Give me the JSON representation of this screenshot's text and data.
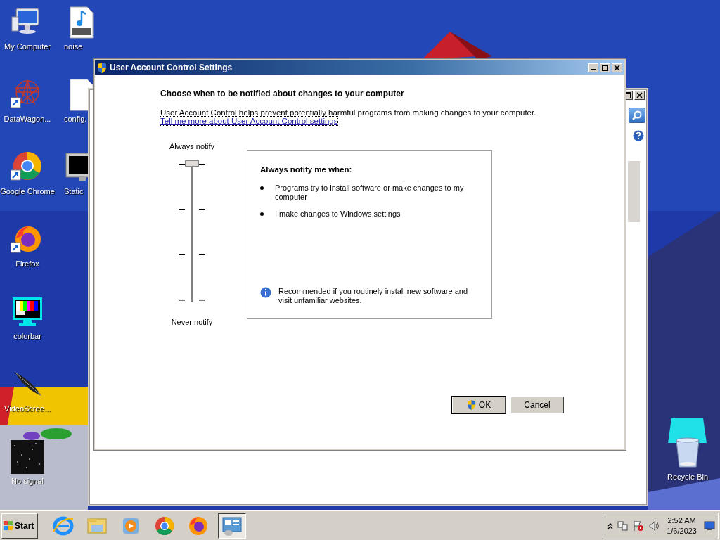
{
  "desktop": {
    "icons": [
      {
        "label": "My Computer",
        "kind": "computer",
        "shortcut": false
      },
      {
        "label": "DataWagon...",
        "kind": "star_pattern",
        "shortcut": true
      },
      {
        "label": "Google Chrome",
        "kind": "chrome",
        "shortcut": true
      },
      {
        "label": "Firefox",
        "kind": "firefox",
        "shortcut": true
      },
      {
        "label": "colorbar",
        "kind": "colorbar",
        "shortcut": false
      },
      {
        "label": "VideoScree...",
        "kind": "feather",
        "shortcut": false
      },
      {
        "label": "No signal",
        "kind": "noise",
        "shortcut": false
      }
    ],
    "icons_column_2": [
      {
        "label": "noise",
        "kind": "audio_file",
        "shortcut": false
      },
      {
        "label": "config.",
        "kind": "document",
        "shortcut": false
      },
      {
        "label": "Static",
        "kind": "monitor",
        "shortcut": false
      }
    ],
    "recycle_bin": {
      "label": "Recycle Bin"
    }
  },
  "dialog": {
    "title": "User Account Control Settings",
    "heading": "Choose when to be notified about changes to your computer",
    "description": "User Account Control helps prevent potentially harmful programs from making changes to your computer.",
    "link": "Tell me more about User Account Control settings",
    "slider": {
      "top_label": "Always notify",
      "bottom_label": "Never notify",
      "level": 1
    },
    "info_box": {
      "title": "Always notify me when:",
      "bullets": [
        "Programs try to install software or make changes to my computer",
        "I make changes to Windows settings"
      ],
      "note": "Recommended if you routinely install new software and visit unfamiliar websites."
    },
    "buttons": [
      {
        "label": "OK",
        "shield": true
      },
      {
        "label": "Cancel",
        "shield": false
      }
    ]
  },
  "taskbar": {
    "start": "Start",
    "apps": [
      {
        "kind": "ie",
        "selected": false
      },
      {
        "kind": "explorer",
        "selected": false
      },
      {
        "kind": "media_player",
        "selected": false
      },
      {
        "kind": "chrome",
        "selected": false
      },
      {
        "kind": "firefox",
        "selected": false
      },
      {
        "kind": "control_panel",
        "selected": true
      }
    ],
    "tray": {
      "time": "2:52 AM",
      "date": "1/6/2023"
    }
  }
}
